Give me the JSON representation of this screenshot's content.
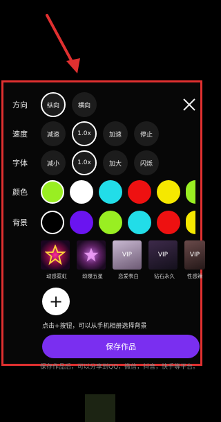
{
  "options": {
    "direction": {
      "label": "方向",
      "items": [
        "纵向",
        "横向"
      ],
      "selected": 0
    },
    "speed": {
      "label": "速度",
      "items": [
        "减速",
        "1.0x",
        "加速",
        "停止"
      ],
      "selected": 1
    },
    "font": {
      "label": "字体",
      "items": [
        "减小",
        "1.0x",
        "加大",
        "闪烁"
      ],
      "selected": 1
    },
    "color": {
      "label": "颜色",
      "swatches": [
        "#99ee22",
        "#ffffff",
        "#22dde8",
        "#ee1111",
        "#f5e800",
        "#99ee22"
      ],
      "selected": 0
    },
    "background": {
      "label": "背景",
      "swatches": [
        "#000000",
        "#6a14f0",
        "#99ee22",
        "#22dde8",
        "#ee1111",
        "#f5e800"
      ],
      "selected": 0
    }
  },
  "backgrounds": [
    {
      "caption": "动感霓虹",
      "vip": ""
    },
    {
      "caption": "劲爆五星",
      "vip": ""
    },
    {
      "caption": "恋爱表白",
      "vip": "VIP"
    },
    {
      "caption": "钻石永久",
      "vip": "VIP"
    },
    {
      "caption": "性感辣",
      "vip": "VIP"
    }
  ],
  "add_hint": "点击+按钮，可以从手机相册选择背景",
  "save_label": "保存作品",
  "bottom_text": "保存作品后，可以分享到QQ，微信，抖音，快手等平台。",
  "colors": {
    "accent": "#7a2ff0",
    "highlight_border": "#e03030"
  },
  "icons": {
    "close": "close-icon",
    "add": "plus-icon",
    "arrow": "arrow-annotation"
  }
}
